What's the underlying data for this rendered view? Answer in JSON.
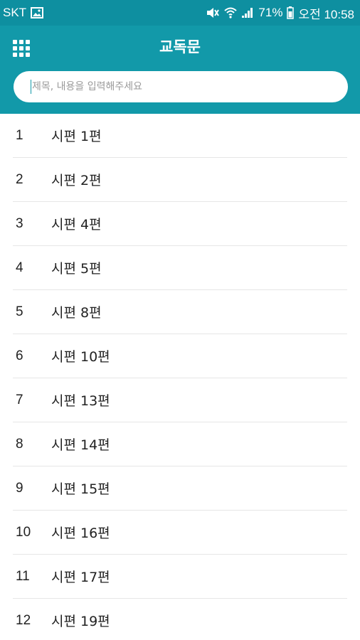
{
  "status_bar": {
    "carrier": "SKT",
    "battery": "71%",
    "time": "오전 10:58"
  },
  "header": {
    "title": "교독문",
    "menu_icon": "grid-menu-icon",
    "search_placeholder": "제목, 내용을 입력해주세요",
    "search_value": ""
  },
  "colors": {
    "status_bar_bg": "#0e8fa0",
    "header_bg": "#1299a9",
    "divider": "#e6e6e6"
  },
  "items": [
    {
      "number": "1",
      "title": "시편 1편"
    },
    {
      "number": "2",
      "title": "시편 2편"
    },
    {
      "number": "3",
      "title": "시편 4편"
    },
    {
      "number": "4",
      "title": "시편 5편"
    },
    {
      "number": "5",
      "title": "시편 8편"
    },
    {
      "number": "6",
      "title": "시편 10편"
    },
    {
      "number": "7",
      "title": "시편 13편"
    },
    {
      "number": "8",
      "title": "시편 14편"
    },
    {
      "number": "9",
      "title": "시편 15편"
    },
    {
      "number": "10",
      "title": "시편 16편"
    },
    {
      "number": "11",
      "title": "시편 17편"
    },
    {
      "number": "12",
      "title": "시편 19편"
    }
  ]
}
